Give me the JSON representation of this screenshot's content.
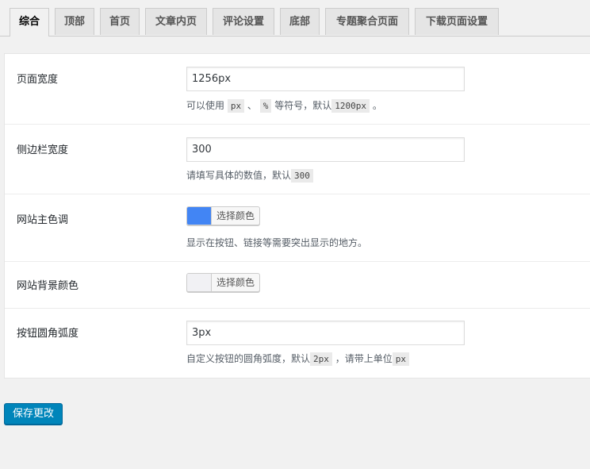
{
  "tabs": [
    {
      "label": "综合",
      "active": true
    },
    {
      "label": "顶部"
    },
    {
      "label": "首页"
    },
    {
      "label": "文章内页"
    },
    {
      "label": "评论设置"
    },
    {
      "label": "底部"
    },
    {
      "label": "专题聚合页面"
    },
    {
      "label": "下载页面设置"
    }
  ],
  "settings": {
    "page_width": {
      "label": "页面宽度",
      "value": "1256px",
      "desc_prefix": "可以使用",
      "code1": "px",
      "sep": "、",
      "code2": "%",
      "desc_mid": "等符号，默认",
      "code3": "1200px",
      "desc_suffix": "。"
    },
    "sidebar_width": {
      "label": "侧边栏宽度",
      "value": "300",
      "desc_prefix": "请填写具体的数值，默认",
      "code1": "300"
    },
    "main_color": {
      "label": "网站主色调",
      "button_label": "选择颜色",
      "swatch_color": "#4285f4",
      "desc": "显示在按钮、链接等需要突出显示的地方。"
    },
    "bg_color": {
      "label": "网站背景颜色",
      "button_label": "选择颜色",
      "swatch_color": "#f1f1f4"
    },
    "button_radius": {
      "label": "按钮圆角弧度",
      "value": "3px",
      "desc_prefix": "自定义按钮的圆角弧度，默认",
      "code1": "2px",
      "desc_mid": "，请带上单位",
      "code2": "px"
    }
  },
  "save_button": {
    "label": "保存更改"
  },
  "colors": {
    "accent": "#0085ba"
  }
}
